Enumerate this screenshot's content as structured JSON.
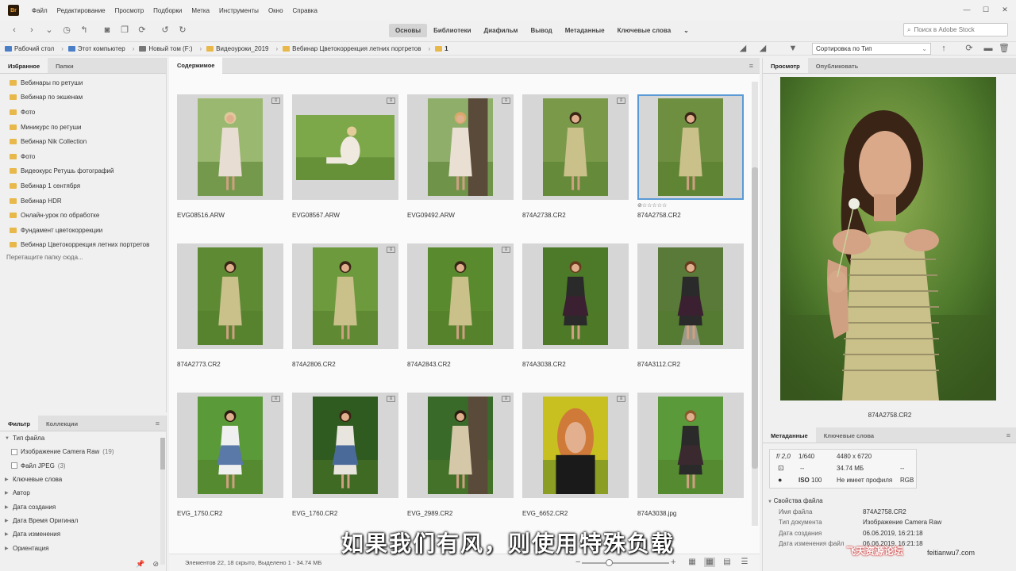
{
  "menu": [
    "Файл",
    "Редактирование",
    "Просмотр",
    "Подборки",
    "Метка",
    "Инструменты",
    "Окно",
    "Справка"
  ],
  "app_icon": "Br",
  "workspaces": [
    "Основы",
    "Библиотеки",
    "Диафильм",
    "Вывод",
    "Метаданные",
    "Ключевые слова"
  ],
  "stock_search_placeholder": "Поиск в Adobe Stock",
  "path": [
    "Рабочий стол",
    "Этот компьютер",
    "Новый том (F:)",
    "Видеоуроки_2019",
    "Вебинар Цветокоррекция летних портретов",
    "1"
  ],
  "sort_label": "Сортировка по Тип",
  "left_tabs": [
    "Избранное",
    "Папки"
  ],
  "favorites": [
    "Вебинары по ретуши",
    "Вебинар по экшенам",
    "Фото",
    "Миникурс по ретуши",
    "Вебинар Nik Collection",
    "Фото",
    "Видеокурс Ретушь фотографий",
    "Вебинар 1 сентября",
    "Вебинар HDR",
    "Онлайн-урок по обработке",
    "Фундамент цветокоррекции",
    "Вебинар Цветокоррекция летних портретов"
  ],
  "drop_hint": "Перетащите папку сюда...",
  "filter_tabs": [
    "Фильтр",
    "Коллекции"
  ],
  "filter": {
    "file_type": "Тип файла",
    "items": [
      {
        "label": "Изображение Camera Raw",
        "count": "(19)"
      },
      {
        "label": "Файл JPEG",
        "count": "(3)"
      }
    ],
    "groups": [
      "Ключевые слова",
      "Автор",
      "Дата создания",
      "Дата Время Оригинал",
      "Дата изменения",
      "Ориентация"
    ]
  },
  "content_tab": "Содержимое",
  "thumbnails": [
    {
      "name": "EVG08516.ARW",
      "adjusted": true,
      "orientation": "portrait"
    },
    {
      "name": "EVG08567.ARW",
      "adjusted": true,
      "orientation": "landscape"
    },
    {
      "name": "EVG09492.ARW",
      "adjusted": true,
      "orientation": "portrait"
    },
    {
      "name": "874A2738.CR2",
      "adjusted": true,
      "orientation": "portrait"
    },
    {
      "name": "874A2758.CR2",
      "adjusted": false,
      "orientation": "portrait",
      "selected": true,
      "rating": 0
    },
    {
      "name": "874A2773.CR2",
      "adjusted": false,
      "orientation": "portrait"
    },
    {
      "name": "874A2806.CR2",
      "adjusted": true,
      "orientation": "portrait"
    },
    {
      "name": "874A2843.CR2",
      "adjusted": true,
      "orientation": "portrait"
    },
    {
      "name": "874A3038.CR2",
      "adjusted": false,
      "orientation": "portrait"
    },
    {
      "name": "874A3112.CR2",
      "adjusted": false,
      "orientation": "portrait"
    },
    {
      "name": "EVG_1750.CR2",
      "adjusted": true,
      "orientation": "portrait"
    },
    {
      "name": "EVG_1760.CR2",
      "adjusted": true,
      "orientation": "portrait"
    },
    {
      "name": "EVG_2989.CR2",
      "adjusted": true,
      "orientation": "portrait"
    },
    {
      "name": "EVG_6652.CR2",
      "adjusted": true,
      "orientation": "portrait"
    },
    {
      "name": "874A3038.jpg",
      "adjusted": false,
      "orientation": "portrait"
    }
  ],
  "status_text": "Элементов 22, 18 скрыто, Выделено 1 - 34.74 МБ",
  "zoom_level": 0.3,
  "right_tabs": [
    "Просмотр",
    "Опубликовать"
  ],
  "preview_name": "874A2758.CR2",
  "meta_tabs": [
    "Метаданные",
    "Ключевые слова"
  ],
  "meta": {
    "aperture": "f/ 2,0",
    "shutter": "1/640",
    "dimensions": "4480 x 6720",
    "size": "34.74 МБ",
    "profile": "Не имеет профиля",
    "iso_label": "ISO",
    "iso": "100",
    "mode": "RGB",
    "dash1": "--",
    "dash2": "--"
  },
  "file_props_title": "Свойства файла",
  "file_props": [
    {
      "k": "Имя файла",
      "v": "874A2758.CR2"
    },
    {
      "k": "Тип документа",
      "v": "Изображение Camera Raw"
    },
    {
      "k": "Дата создания",
      "v": "06.06.2019, 16:21:18"
    },
    {
      "k": "Дата изменения файл",
      "v": "06.06.2019, 16:21:18"
    }
  ],
  "subtitle": "如果我们有风，则使用特殊负载",
  "watermark": "飞天资源论坛",
  "watermark_url": "feitianwu7.com",
  "colors": {
    "accent": "#5a9ad6",
    "folder": "#e8b84a"
  }
}
